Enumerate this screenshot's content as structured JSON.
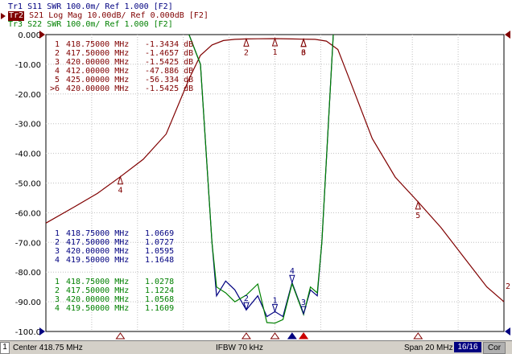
{
  "traces": {
    "tr1": {
      "id": "Tr1",
      "param": "S11",
      "format": "SWR 100.0m/ Ref 1.000 [F2]",
      "color": "#000080"
    },
    "tr2": {
      "id": "Tr2",
      "param": "S21",
      "format": "Log Mag 10.00dB/ Ref 0.000dB [F2]",
      "color": "#800000"
    },
    "tr3": {
      "id": "Tr3",
      "param": "S22",
      "format": "SWR 100.0m/ Ref 1.000 [F2]",
      "color": "#008000"
    }
  },
  "y_axis": {
    "labels": [
      "0.000",
      "-10.00",
      "-20.00",
      "-30.00",
      "-40.00",
      "-50.00",
      "-60.00",
      "-70.00",
      "-80.00",
      "-90.00",
      "-100.0"
    ]
  },
  "marker_tables": {
    "s21": [
      {
        "prefix": "1",
        "freq": "418.75000 MHz",
        "value": "-1.3434 dB"
      },
      {
        "prefix": "2",
        "freq": "417.50000 MHz",
        "value": "-1.4657 dB"
      },
      {
        "prefix": "3",
        "freq": "420.00000 MHz",
        "value": "-1.5425 dB"
      },
      {
        "prefix": "4",
        "freq": "412.00000 MHz",
        "value": "-47.886 dB"
      },
      {
        "prefix": "5",
        "freq": "425.00000 MHz",
        "value": "-56.334 dB"
      },
      {
        "prefix": ">6",
        "freq": "420.00000 MHz",
        "value": "-1.5425 dB"
      }
    ],
    "s11": [
      {
        "prefix": "1",
        "freq": "418.75000 MHz",
        "value": "1.0669"
      },
      {
        "prefix": "2",
        "freq": "417.50000 MHz",
        "value": "1.0727"
      },
      {
        "prefix": "3",
        "freq": "420.00000 MHz",
        "value": "1.0595"
      },
      {
        "prefix": "4",
        "freq": "419.50000 MHz",
        "value": "1.1648"
      }
    ],
    "s22": [
      {
        "prefix": "1",
        "freq": "418.75000 MHz",
        "value": "1.0278"
      },
      {
        "prefix": "2",
        "freq": "417.50000 MHz",
        "value": "1.1224"
      },
      {
        "prefix": "3",
        "freq": "420.00000 MHz",
        "value": "1.0568"
      },
      {
        "prefix": "4",
        "freq": "419.50000 MHz",
        "value": "1.1609"
      }
    ]
  },
  "markers_on_plot": {
    "s21": [
      {
        "label": "1",
        "freq_mhz": 418.75,
        "db": -1.3434
      },
      {
        "label": "2",
        "freq_mhz": 417.5,
        "db": -1.4657
      },
      {
        "label": "3",
        "freq_mhz": 420.0,
        "db": -1.5425
      },
      {
        "label": "4",
        "freq_mhz": 412.0,
        "db": -47.886
      },
      {
        "label": "5",
        "freq_mhz": 425.0,
        "db": -56.334
      },
      {
        "label": "6",
        "freq_mhz": 420.0,
        "db": -1.5425
      }
    ],
    "swr": [
      {
        "label": "4",
        "freq_mhz": 419.5,
        "swr": 1.1648
      },
      {
        "label": "1",
        "freq_mhz": 418.75,
        "swr": 1.0669
      },
      {
        "label": "2",
        "freq_mhz": 417.5,
        "swr": 1.0727
      },
      {
        "label": "3",
        "freq_mhz": 420.0,
        "swr": 1.0595
      }
    ],
    "right_edge_label": "2"
  },
  "status": {
    "channel": "1",
    "center": "Center 418.75 MHz",
    "ifbw": "IFBW 70 kHz",
    "span": "Span 20 MHz",
    "points": "16/16",
    "correction": "Cor"
  },
  "chart_data": {
    "type": "line",
    "x": [
      408.75,
      410,
      411,
      412,
      413,
      414,
      415,
      415.5,
      416,
      416.5,
      417,
      417.5,
      418,
      418.75,
      419.5,
      420,
      420.5,
      421,
      421.5,
      422,
      423,
      424,
      425,
      426,
      427,
      428,
      428.75
    ],
    "series": [
      {
        "name": "S21",
        "values": [
          -63.5,
          -58,
          -53.5,
          -47.886,
          -42,
          -33.5,
          -15,
          -7,
          -3.5,
          -2,
          -1.6,
          -1.4657,
          -1.4,
          -1.3434,
          -1.45,
          -1.5425,
          -1.6,
          -2.2,
          -5,
          -15,
          -35,
          -48,
          -56.334,
          -65,
          -75,
          -85,
          -90
        ],
        "color": "#800000"
      },
      {
        "name": "S11",
        "x": [
          415.0,
          415.5,
          416.0,
          416.2,
          416.6,
          417.0,
          417.5,
          418.0,
          418.4,
          418.75,
          419.1,
          419.5,
          420.0,
          420.3,
          420.6,
          420.8,
          421.3
        ],
        "values": [
          2.0,
          1.9,
          1.3,
          1.12,
          1.17,
          1.14,
          1.0727,
          1.12,
          1.05,
          1.0669,
          1.05,
          1.1648,
          1.0595,
          1.14,
          1.12,
          1.3,
          2.0
        ],
        "color": "#000080"
      },
      {
        "name": "S22",
        "x": [
          415.0,
          415.5,
          416.0,
          416.2,
          416.6,
          417.0,
          417.5,
          418.0,
          418.4,
          418.75,
          419.1,
          419.5,
          420.0,
          420.3,
          420.6,
          420.8,
          421.3
        ],
        "values": [
          2.0,
          1.9,
          1.3,
          1.15,
          1.13,
          1.1,
          1.1224,
          1.16,
          1.03,
          1.0278,
          1.04,
          1.1609,
          1.0568,
          1.15,
          1.13,
          1.3,
          2.0
        ],
        "color": "#008000"
      }
    ],
    "xlim": [
      408.75,
      428.75
    ],
    "ylim": [
      -100,
      0
    ],
    "swr_ylim": [
      1.0,
      2.0
    ],
    "grid": true
  }
}
